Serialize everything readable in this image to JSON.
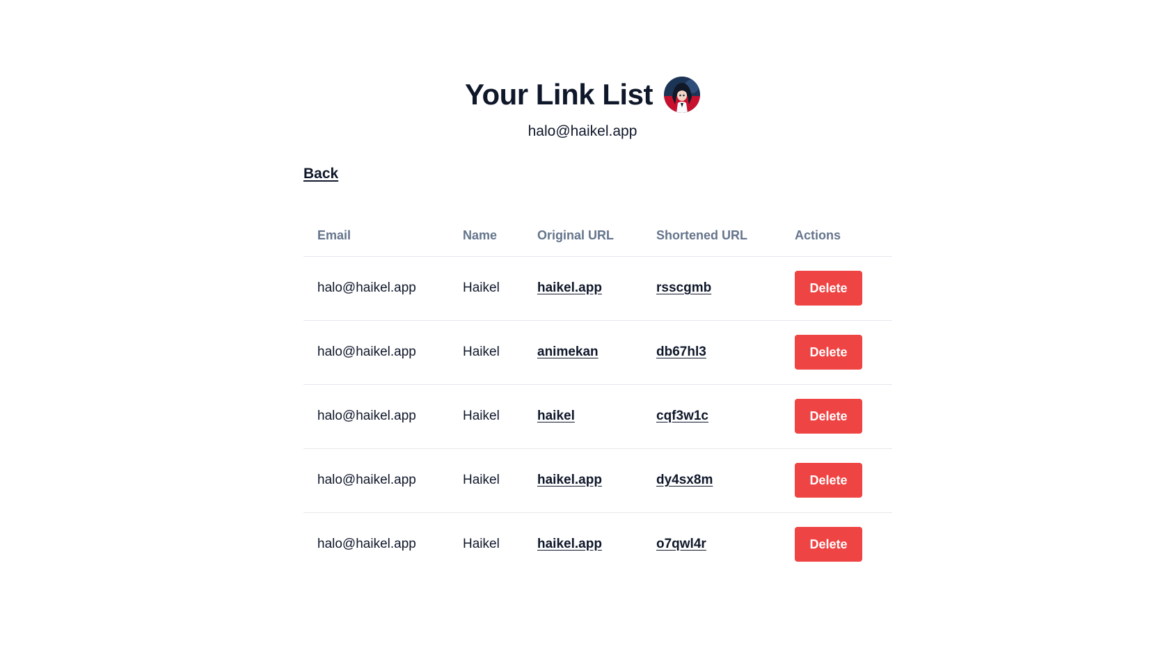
{
  "header": {
    "title": "Your Link List",
    "email": "halo@haikel.app"
  },
  "nav": {
    "back_label": "Back"
  },
  "table": {
    "columns": [
      "Email",
      "Name",
      "Original URL",
      "Shortened URL",
      "Actions"
    ],
    "rows": [
      {
        "email": "halo@haikel.app",
        "name": "Haikel",
        "original_url": "haikel.app",
        "short_url": "rsscgmb",
        "action": "Delete"
      },
      {
        "email": "halo@haikel.app",
        "name": "Haikel",
        "original_url": "animekan",
        "short_url": "db67hl3",
        "action": "Delete"
      },
      {
        "email": "halo@haikel.app",
        "name": "Haikel",
        "original_url": "haikel",
        "short_url": "cqf3w1c",
        "action": "Delete"
      },
      {
        "email": "halo@haikel.app",
        "name": "Haikel",
        "original_url": "haikel.app",
        "short_url": "dy4sx8m",
        "action": "Delete"
      },
      {
        "email": "halo@haikel.app",
        "name": "Haikel",
        "original_url": "haikel.app",
        "short_url": "o7qwl4r",
        "action": "Delete"
      }
    ]
  },
  "colors": {
    "text": "#0f172a",
    "muted_header": "#64748b",
    "delete_button": "#ef4444",
    "divider": "#e5e7eb"
  },
  "icons": {
    "avatar": "user-avatar-anime"
  }
}
